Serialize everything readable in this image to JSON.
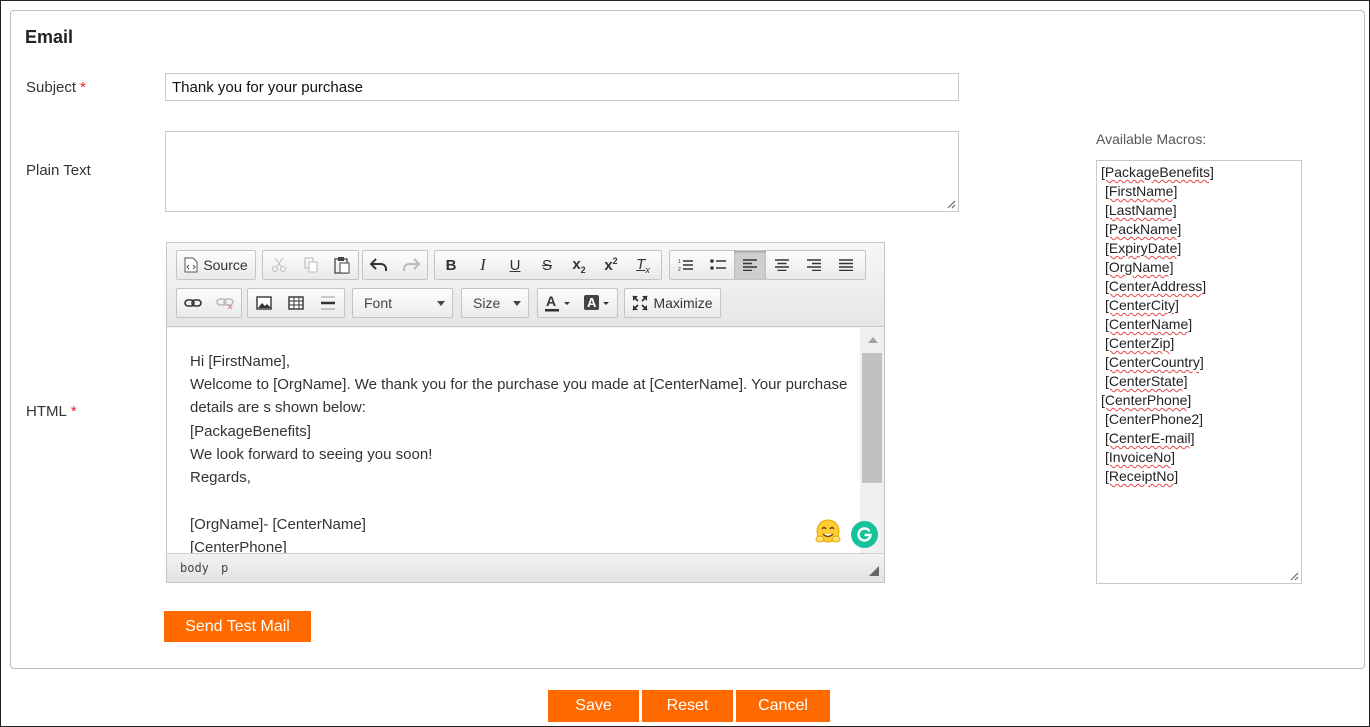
{
  "form": {
    "section_title": "Email",
    "subject_label": "Subject",
    "required_mark": "*",
    "subject_value": "Thank you for your purchase",
    "plain_text_label": "Plain Text",
    "plain_text_value": "",
    "html_label": "HTML"
  },
  "toolbar": {
    "source_label": "Source",
    "font_label": "Font",
    "size_label": "Size",
    "maximize_label": "Maximize",
    "active_alignment": "align-left"
  },
  "editor": {
    "lines": [
      "Hi [FirstName],",
      "Welcome to [OrgName]. We thank you for the purchase you made at [CenterName]. Your purchase",
      "details are s shown below:",
      "[PackageBenefits]",
      "We look forward to seeing you soon!",
      "Regards,",
      "",
      "[OrgName]- [CenterName]",
      "[CenterPhone]"
    ],
    "path": [
      "body",
      "p"
    ]
  },
  "macros": {
    "label": "Available Macros:",
    "items": [
      "[PackageBenefits]",
      "[FirstName]",
      "[LastName]",
      "[PackName]",
      "[ExpiryDate]",
      "[OrgName]",
      "[CenterAddress]",
      "[CenterCity]",
      "[CenterName]",
      "[CenterZip]",
      "[CenterCountry]",
      "[CenterState]",
      "[CenterPhone]",
      "[CenterPhone2]",
      "[CenterE-mail]",
      "[InvoiceNo]",
      "[ReceiptNo]"
    ]
  },
  "actions": {
    "send_test_mail": "Send Test Mail",
    "save": "Save",
    "reset": "Reset",
    "cancel": "Cancel"
  },
  "colors": {
    "accent": "#ff6a00",
    "required": "#e0262a",
    "grammarly": "#15c39a"
  }
}
